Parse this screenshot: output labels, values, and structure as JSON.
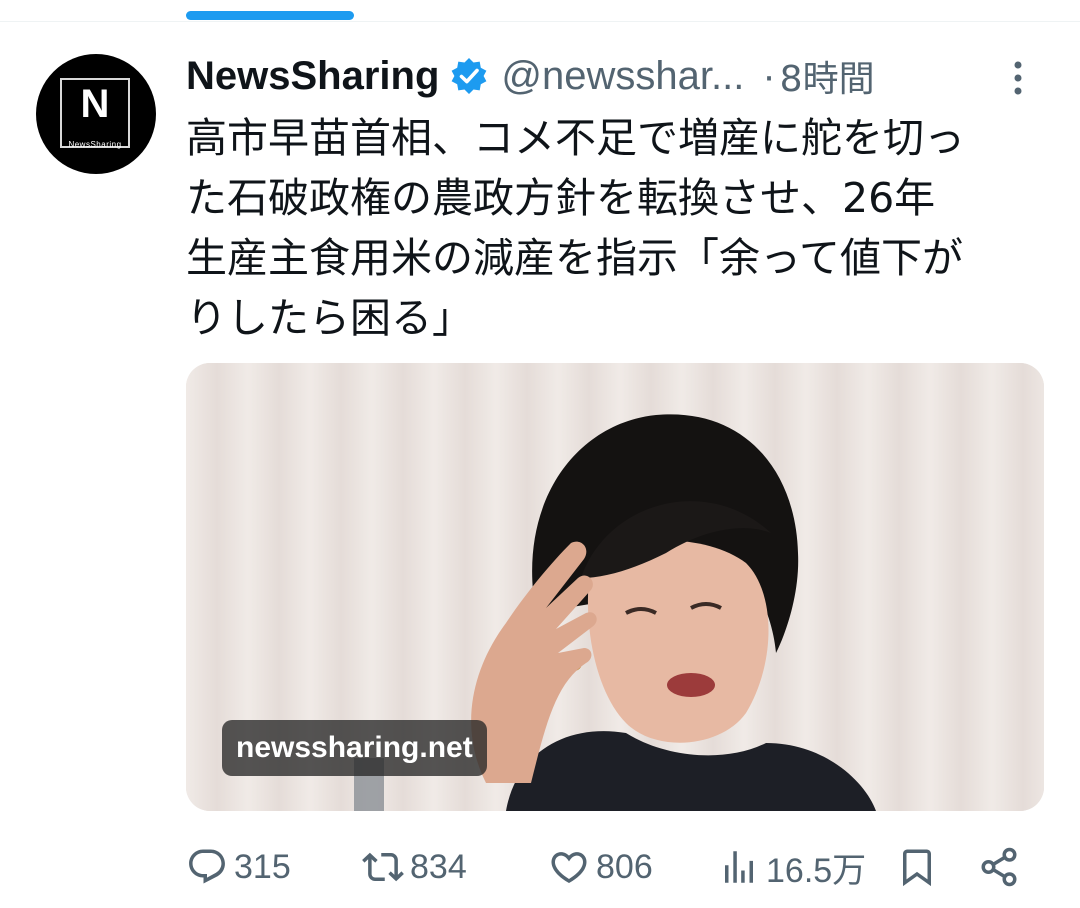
{
  "post": {
    "author_name": "NewsSharing",
    "avatar_letter": "N",
    "avatar_caption": "NewsSharing",
    "handle": "@newsshar...",
    "separator": "·",
    "time": "8時間",
    "text_lines": [
      "高市早苗首相、コメ不足で増産に舵を切っ",
      "た石破政権の農政方針を転換させ、26年",
      "生産主食用米の減産を指示「余って値下が",
      "りしたら困る」"
    ],
    "media_watermark": "newssharing.net"
  },
  "actions": {
    "replies": "315",
    "reposts": "834",
    "likes": "806",
    "views": "16.5万"
  },
  "colors": {
    "accent": "#1d9bf0",
    "text": "#0f1419",
    "muted": "#536471"
  },
  "icons": [
    "reply-icon",
    "repost-icon",
    "like-icon",
    "views-icon",
    "bookmark-icon",
    "share-icon",
    "verified-icon",
    "more-icon"
  ]
}
